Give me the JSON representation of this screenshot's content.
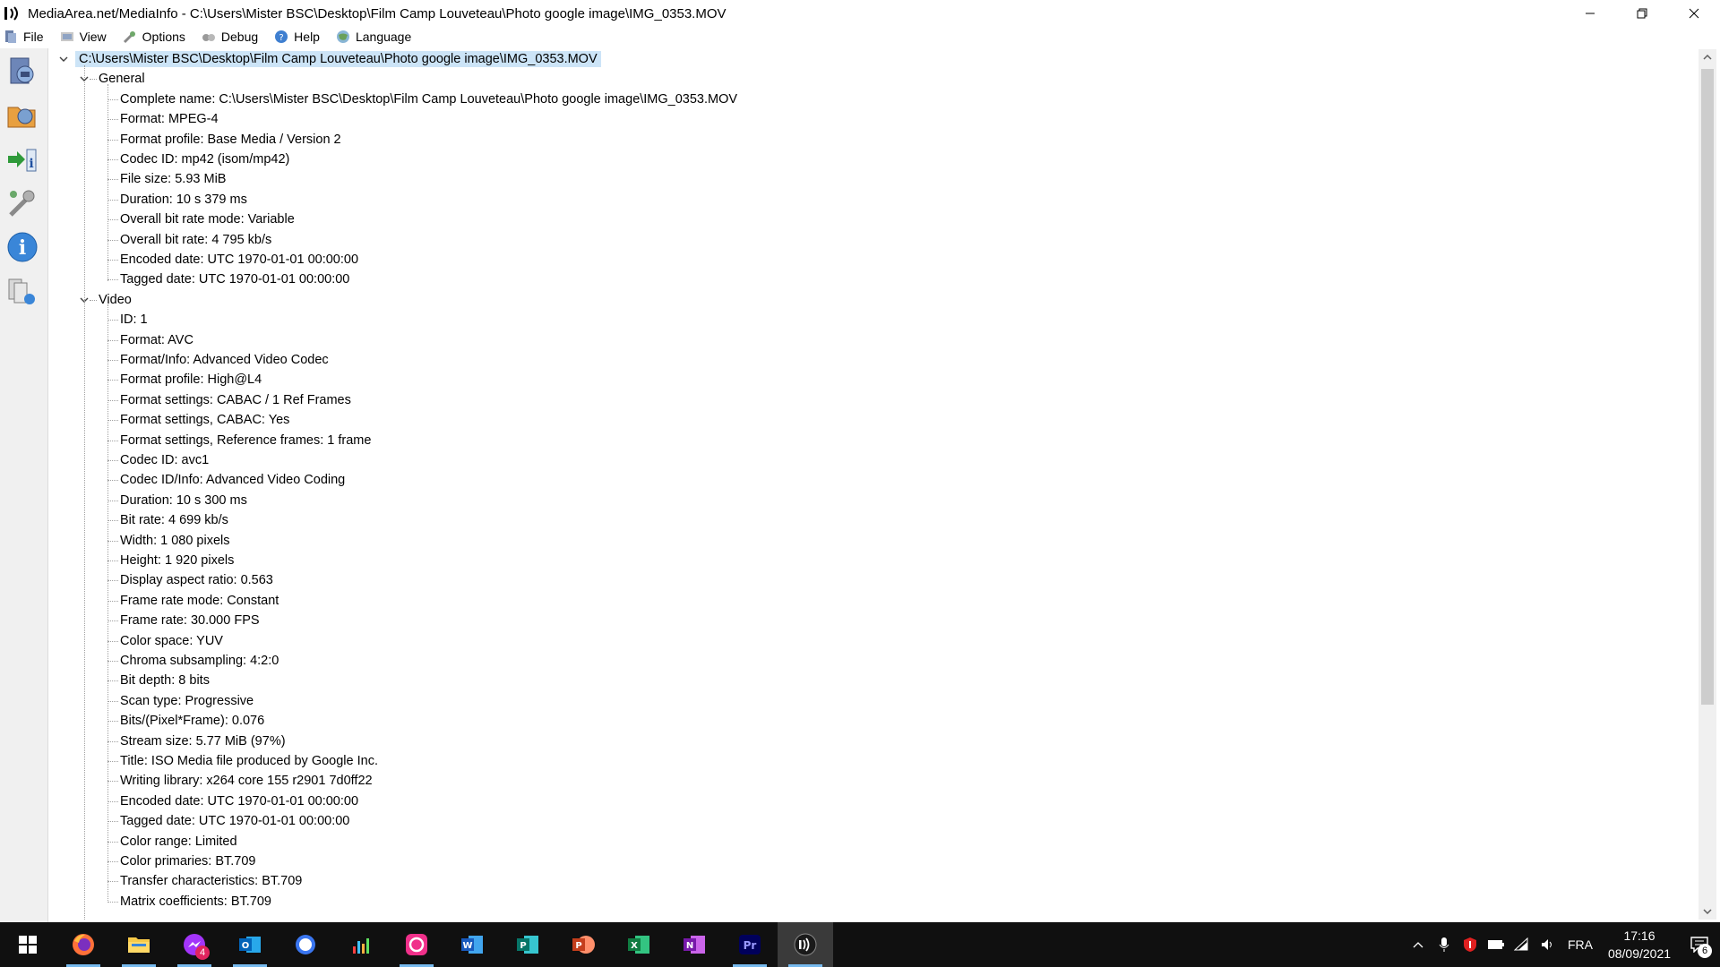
{
  "window": {
    "title": "MediaArea.net/MediaInfo - C:\\Users\\Mister BSC\\Desktop\\Film Camp Louveteau\\Photo google image\\IMG_0353.MOV"
  },
  "menu": [
    {
      "label": "File",
      "icon": "file-menu-icon"
    },
    {
      "label": "View",
      "icon": "view-menu-icon"
    },
    {
      "label": "Options",
      "icon": "options-menu-icon"
    },
    {
      "label": "Debug",
      "icon": "debug-menu-icon"
    },
    {
      "label": "Help",
      "icon": "help-menu-icon"
    },
    {
      "label": "Language",
      "icon": "language-menu-icon"
    }
  ],
  "toolbar": [
    "open-file-icon",
    "open-folder-icon",
    "export-icon",
    "preferences-icon",
    "about-icon",
    "knowledge-base-icon"
  ],
  "tree": {
    "root": "C:\\Users\\Mister BSC\\Desktop\\Film Camp Louveteau\\Photo google image\\IMG_0353.MOV",
    "sections": [
      {
        "name": "General",
        "items": [
          "Complete name: C:\\Users\\Mister BSC\\Desktop\\Film Camp Louveteau\\Photo google image\\IMG_0353.MOV",
          "Format: MPEG-4",
          "Format profile: Base Media / Version 2",
          "Codec ID: mp42 (isom/mp42)",
          "File size: 5.93 MiB",
          "Duration: 10 s 379 ms",
          "Overall bit rate mode: Variable",
          "Overall bit rate: 4 795 kb/s",
          "Encoded date: UTC 1970-01-01 00:00:00",
          "Tagged date: UTC 1970-01-01 00:00:00"
        ]
      },
      {
        "name": "Video",
        "items": [
          "ID: 1",
          "Format: AVC",
          "Format/Info: Advanced Video Codec",
          "Format profile: High@L4",
          "Format settings: CABAC / 1 Ref Frames",
          "Format settings, CABAC: Yes",
          "Format settings, Reference frames: 1 frame",
          "Codec ID: avc1",
          "Codec ID/Info: Advanced Video Coding",
          "Duration: 10 s 300 ms",
          "Bit rate: 4 699 kb/s",
          "Width: 1 080 pixels",
          "Height: 1 920 pixels",
          "Display aspect ratio: 0.563",
          "Frame rate mode: Constant",
          "Frame rate: 30.000 FPS",
          "Color space: YUV",
          "Chroma subsampling: 4:2:0",
          "Bit depth: 8 bits",
          "Scan type: Progressive",
          "Bits/(Pixel*Frame): 0.076",
          "Stream size: 5.77 MiB (97%)",
          "Title: ISO Media file produced by Google Inc.",
          "Writing library: x264 core 155 r2901 7d0ff22",
          "Encoded date: UTC 1970-01-01 00:00:00",
          "Tagged date: UTC 1970-01-01 00:00:00",
          "Color range: Limited",
          "Color primaries: BT.709",
          "Transfer characteristics: BT.709",
          "Matrix coefficients: BT.709"
        ]
      }
    ]
  },
  "taskbar": {
    "apps": [
      {
        "name": "start-icon",
        "running": false
      },
      {
        "name": "firefox-icon",
        "running": true
      },
      {
        "name": "file-explorer-icon",
        "running": true
      },
      {
        "name": "messenger-icon",
        "running": true,
        "badge": "4"
      },
      {
        "name": "outlook-icon",
        "running": true
      },
      {
        "name": "signal-icon",
        "running": false
      },
      {
        "name": "equalizer-icon",
        "running": false
      },
      {
        "name": "photo-app-icon",
        "running": true
      },
      {
        "name": "word-icon",
        "running": false
      },
      {
        "name": "publisher-icon",
        "running": false
      },
      {
        "name": "powerpoint-icon",
        "running": false
      },
      {
        "name": "excel-icon",
        "running": false
      },
      {
        "name": "onenote-icon",
        "running": false
      },
      {
        "name": "premiere-pro-icon",
        "running": true
      },
      {
        "name": "mediainfo-icon",
        "running": true,
        "active": true
      }
    ],
    "tray": {
      "language": "FRA",
      "time": "17:16",
      "date": "08/09/2021",
      "notifications": "6"
    }
  }
}
